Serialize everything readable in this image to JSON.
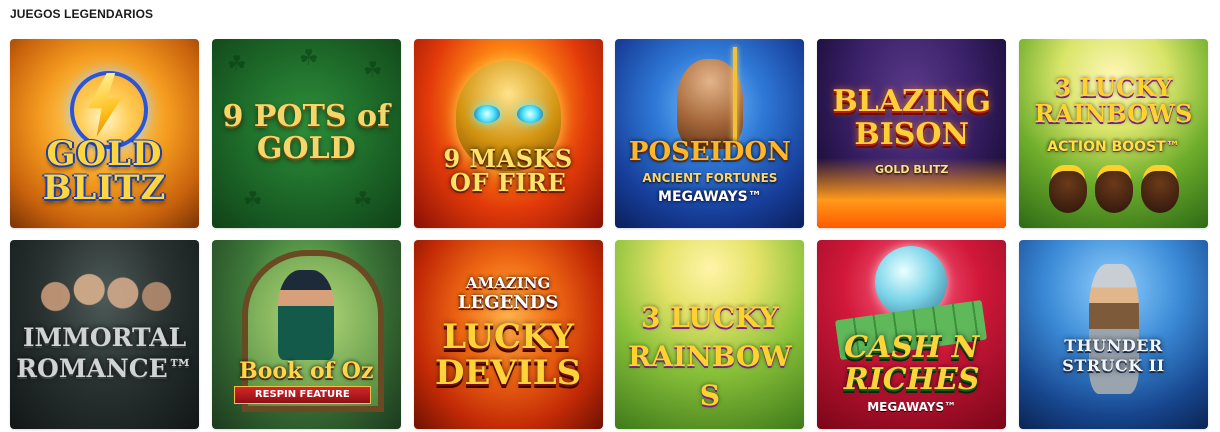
{
  "section": {
    "title": "JUEGOS LEGENDARIOS"
  },
  "games": [
    {
      "id": "gold-blitz",
      "title": "GOLD BLITZ",
      "subtitle": "",
      "subtitle2": ""
    },
    {
      "id": "9-pots-of-gold",
      "title": "9 POTS of GOLD",
      "subtitle": "",
      "subtitle2": ""
    },
    {
      "id": "9-masks-of-fire",
      "title": "9 MASKS OF FIRE",
      "subtitle": "",
      "subtitle2": ""
    },
    {
      "id": "poseidon",
      "title": "POSEIDON",
      "subtitle": "ANCIENT FORTUNES",
      "subtitle2": "MEGAWAYS™"
    },
    {
      "id": "blazing-bison",
      "title": "BLAZING BISON",
      "subtitle": "GOLD BLITZ",
      "subtitle2": ""
    },
    {
      "id": "3-lucky-rainbows-action-boost",
      "title": "3 LUCKY RAINBOWS",
      "subtitle": "ACTION BOOST™",
      "subtitle2": ""
    },
    {
      "id": "immortal-romance",
      "title": "IMMORTAL ROMANCE™",
      "subtitle": "",
      "subtitle2": ""
    },
    {
      "id": "book-of-oz",
      "title": "Book of Oz",
      "subtitle": "RESPIN FEATURE",
      "subtitle2": ""
    },
    {
      "id": "amazing-legends-lucky-devils",
      "title": "Lucky DEVILS",
      "subtitle": "AMAZING",
      "subtitle2": "LEGENDS"
    },
    {
      "id": "3-lucky-rainbows",
      "title": "3 LUCKY RAINBOWS",
      "subtitle": "",
      "subtitle2": ""
    },
    {
      "id": "cash-n-riches-megaways",
      "title": "CASH N RICHES",
      "subtitle": "MEGAWAYS™",
      "subtitle2": ""
    },
    {
      "id": "thunderstruck-2",
      "title": "THUNDER STRUCK II",
      "subtitle": "",
      "subtitle2": ""
    }
  ]
}
